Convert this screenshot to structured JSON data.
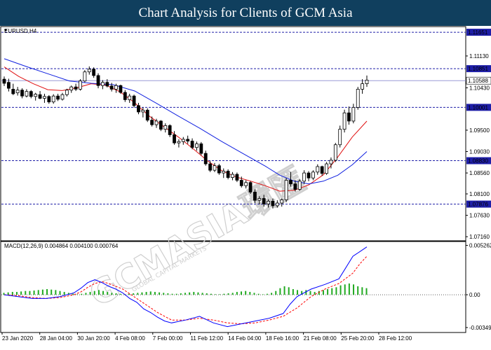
{
  "title": "Chart Analysis for Clients of GCM Asia",
  "watermark": {
    "main": "GCMASIA環匯",
    "sub": "GLOBAL CAPITAL MARKETS"
  },
  "chart_data": [
    {
      "type": "candlestick",
      "symbol": "EURUSD,H4",
      "ylim": [
        1.0707,
        1.11775
      ],
      "y_ticks": [
        "1.11130",
        "1.10430",
        "1.09500",
        "1.09030",
        "1.08560",
        "1.08100",
        "1.07630",
        "1.07160"
      ],
      "x_labels": [
        "23 Jan 2020",
        "28 Jan 04:00",
        "30 Jan 20:00",
        "4 Feb 08:00",
        "7 Feb 00:00",
        "11 Feb 12:00",
        "14 Feb 04:00",
        "18 Feb 16:00",
        "21 Feb 08:00",
        "25 Feb 20:00",
        "28 Feb 12:00"
      ],
      "levels": [
        {
          "value": 1.11651,
          "label": "1.11651"
        },
        {
          "value": 1.10851,
          "label": "1.10851"
        },
        {
          "value": 1.10001,
          "label": "1.10001"
        },
        {
          "value": 1.0883,
          "label": "1.08830"
        },
        {
          "value": 1.07876,
          "label": "1.07876"
        }
      ],
      "current_price": {
        "value": 1.10588,
        "label": "1.10588"
      },
      "colors": {
        "levels": "#1e1ea8",
        "fast_ma": "#e01010",
        "slow_ma": "#1020e0",
        "candle": "#000000",
        "current": "#0000ff"
      },
      "series": [
        {
          "name": "Fast MA",
          "color": "#e01010",
          "points": [
            [
              0,
              1.1089
            ],
            [
              10,
              1.1068
            ],
            [
              20,
              1.1052
            ],
            [
              30,
              1.1039
            ],
            [
              40,
              1.1037
            ],
            [
              50,
              1.1043
            ],
            [
              60,
              1.1052
            ],
            [
              70,
              1.1049
            ],
            [
              80,
              1.1034
            ],
            [
              90,
              1.101
            ],
            [
              100,
              1.0981
            ],
            [
              110,
              1.0958
            ],
            [
              120,
              1.0935
            ],
            [
              130,
              1.091
            ],
            [
              140,
              1.0883
            ],
            [
              150,
              1.0861
            ],
            [
              160,
              1.0847
            ],
            [
              170,
              1.0838
            ],
            [
              180,
              1.0828
            ],
            [
              190,
              1.0816
            ],
            [
              200,
              1.0818
            ],
            [
              210,
              1.083
            ],
            [
              220,
              1.0852
            ],
            [
              230,
              1.0891
            ],
            [
              240,
              1.0935
            ],
            [
              250,
              1.097
            ]
          ]
        },
        {
          "name": "Slow MA",
          "color": "#1020e0",
          "points": [
            [
              0,
              1.1107
            ],
            [
              15,
              1.109
            ],
            [
              30,
              1.1074
            ],
            [
              45,
              1.1058
            ],
            [
              60,
              1.1053
            ],
            [
              75,
              1.105
            ],
            [
              90,
              1.1036
            ],
            [
              105,
              1.1009
            ],
            [
              120,
              1.0981
            ],
            [
              135,
              1.0954
            ],
            [
              150,
              1.0925
            ],
            [
              165,
              1.0898
            ],
            [
              180,
              1.0871
            ],
            [
              190,
              1.0851
            ],
            [
              200,
              1.0838
            ],
            [
              210,
              1.0832
            ],
            [
              220,
              1.0838
            ],
            [
              230,
              1.0851
            ],
            [
              240,
              1.0874
            ],
            [
              250,
              1.0903
            ]
          ]
        }
      ],
      "candles": [
        [
          1.1062,
          1.1068,
          1.1047,
          1.1053
        ],
        [
          1.1055,
          1.1063,
          1.1035,
          1.1042
        ],
        [
          1.104,
          1.1052,
          1.1027,
          1.103
        ],
        [
          1.1032,
          1.1045,
          1.1026,
          1.1038
        ],
        [
          1.1038,
          1.1042,
          1.102,
          1.1025
        ],
        [
          1.1025,
          1.104,
          1.1022,
          1.1035
        ],
        [
          1.1035,
          1.1038,
          1.102,
          1.1024
        ],
        [
          1.1024,
          1.1032,
          1.1015,
          1.1029
        ],
        [
          1.1028,
          1.1036,
          1.1018,
          1.102
        ],
        [
          1.102,
          1.103,
          1.101,
          1.1024
        ],
        [
          1.1024,
          1.1027,
          1.1008,
          1.1012
        ],
        [
          1.1012,
          1.1029,
          1.1008,
          1.1025
        ],
        [
          1.1025,
          1.103,
          1.1014,
          1.1018
        ],
        [
          1.1018,
          1.1032,
          1.1015,
          1.1028
        ],
        [
          1.1028,
          1.1041,
          1.1024,
          1.1038
        ],
        [
          1.1038,
          1.1048,
          1.1032,
          1.1045
        ],
        [
          1.1045,
          1.1052,
          1.1036,
          1.104
        ],
        [
          1.104,
          1.1062,
          1.1037,
          1.1058
        ],
        [
          1.1058,
          1.1082,
          1.1055,
          1.1078
        ],
        [
          1.1078,
          1.109,
          1.1072,
          1.1084
        ],
        [
          1.1084,
          1.1088,
          1.1065,
          1.107
        ],
        [
          1.107,
          1.1075,
          1.1042,
          1.1048
        ],
        [
          1.1048,
          1.106,
          1.104,
          1.1055
        ],
        [
          1.1055,
          1.1062,
          1.1044,
          1.1047
        ],
        [
          1.1047,
          1.1054,
          1.1035,
          1.104
        ],
        [
          1.104,
          1.1052,
          1.1032,
          1.1048
        ],
        [
          1.1048,
          1.105,
          1.103,
          1.1033
        ],
        [
          1.1033,
          1.1038,
          1.1012,
          1.1017
        ],
        [
          1.1017,
          1.103,
          1.101,
          1.1025
        ],
        [
          1.1025,
          1.1028,
          1.1,
          1.1004
        ],
        [
          1.1004,
          1.101,
          1.0985,
          1.099
        ],
        [
          1.099,
          1.1,
          1.0978,
          1.0994
        ],
        [
          1.0994,
          1.0998,
          1.0968,
          1.0972
        ],
        [
          1.0972,
          1.098,
          1.0958,
          1.0962
        ],
        [
          1.0962,
          1.0975,
          1.0955,
          1.097
        ],
        [
          1.097,
          1.0972,
          1.0948,
          1.0952
        ],
        [
          1.0952,
          1.0965,
          1.0945,
          1.096
        ],
        [
          1.096,
          1.0963,
          1.0935,
          1.094
        ],
        [
          1.094,
          1.0948,
          1.0918,
          1.0922
        ],
        [
          1.0922,
          1.093,
          1.0912,
          1.0925
        ],
        [
          1.0925,
          1.0935,
          1.0918,
          1.093
        ],
        [
          1.093,
          1.0938,
          1.092,
          1.0926
        ],
        [
          1.0926,
          1.0932,
          1.0908,
          1.0912
        ],
        [
          1.0912,
          1.0925,
          1.0905,
          1.092
        ],
        [
          1.092,
          1.0924,
          1.0895,
          1.0899
        ],
        [
          1.0899,
          1.0905,
          1.0872,
          1.0876
        ],
        [
          1.0876,
          1.0882,
          1.0858,
          1.0862
        ],
        [
          1.0862,
          1.0878,
          1.0858,
          1.0872
        ],
        [
          1.0872,
          1.0876,
          1.0852,
          1.0856
        ],
        [
          1.0856,
          1.0866,
          1.0845,
          1.086
        ],
        [
          1.086,
          1.0864,
          1.0842,
          1.0846
        ],
        [
          1.0846,
          1.0858,
          1.084,
          1.0853
        ],
        [
          1.0853,
          1.0857,
          1.0836,
          1.084
        ],
        [
          1.084,
          1.0848,
          1.0824,
          1.0828
        ],
        [
          1.0828,
          1.084,
          1.0822,
          1.0835
        ],
        [
          1.0835,
          1.0838,
          1.081,
          1.0814
        ],
        [
          1.0814,
          1.082,
          1.079,
          1.0796
        ],
        [
          1.0796,
          1.0805,
          1.0787,
          1.08
        ],
        [
          1.08,
          1.0808,
          1.0782,
          1.0788
        ],
        [
          1.0788,
          1.0798,
          1.078,
          1.0794
        ],
        [
          1.0794,
          1.08,
          1.0778,
          1.0784
        ],
        [
          1.0784,
          1.0796,
          1.078,
          1.079
        ],
        [
          1.079,
          1.08,
          1.0782,
          1.0797
        ],
        [
          1.0797,
          1.0845,
          1.0792,
          1.084
        ],
        [
          1.084,
          1.0858,
          1.0826,
          1.0832
        ],
        [
          1.0832,
          1.084,
          1.0815,
          1.082
        ],
        [
          1.082,
          1.0842,
          1.0817,
          1.0838
        ],
        [
          1.0838,
          1.0862,
          1.0832,
          1.0856
        ],
        [
          1.0856,
          1.086,
          1.0838,
          1.0845
        ],
        [
          1.0845,
          1.0862,
          1.084,
          1.0858
        ],
        [
          1.0858,
          1.0875,
          1.0852,
          1.087
        ],
        [
          1.087,
          1.0872,
          1.085,
          1.0855
        ],
        [
          1.0855,
          1.088,
          1.0852,
          1.0876
        ],
        [
          1.0876,
          1.089,
          1.0866,
          1.0884
        ],
        [
          1.0884,
          1.0922,
          1.088,
          1.0918
        ],
        [
          1.0918,
          1.096,
          1.0912,
          1.0952
        ],
        [
          1.0952,
          1.0995,
          1.0945,
          1.0988
        ],
        [
          1.0988,
          1.1002,
          1.0962,
          1.097
        ],
        [
          1.097,
          1.1008,
          1.0965,
          1.1
        ],
        [
          1.1,
          1.1045,
          1.0995,
          1.104
        ],
        [
          1.104,
          1.1062,
          1.103,
          1.1052
        ],
        [
          1.1052,
          1.107,
          1.1045,
          1.106
        ]
      ]
    },
    {
      "type": "line",
      "name": "MACD(12,26,9) 0.004864 0.004100 0.000764",
      "ylim": [
        -0.00395,
        0.0056
      ],
      "y_ticks": [
        "0.005262",
        "0.00",
        "-0.003495"
      ],
      "colors": {
        "histogram": "#22aa22",
        "macd": "#0000ff",
        "signal": "#ff0000",
        "zero": "#000000"
      },
      "macd": [
        [
          0,
          0
        ],
        [
          20,
          -0.0002
        ],
        [
          40,
          -0.0004
        ],
        [
          60,
          -0.0004
        ],
        [
          80,
          -0.0002
        ],
        [
          100,
          0.0002
        ],
        [
          110,
          0.0007
        ],
        [
          120,
          0.0013
        ],
        [
          130,
          0.0016
        ],
        [
          140,
          0.0013
        ],
        [
          150,
          0.0009
        ],
        [
          160,
          0.0006
        ],
        [
          170,
          0.0002
        ],
        [
          180,
          -0.0004
        ],
        [
          190,
          -0.0008
        ],
        [
          200,
          -0.0015
        ],
        [
          210,
          -0.0019
        ],
        [
          220,
          -0.0024
        ],
        [
          230,
          -0.0028
        ],
        [
          240,
          -0.003
        ],
        [
          260,
          -0.0027
        ],
        [
          280,
          -0.0023
        ],
        [
          300,
          -0.003
        ],
        [
          320,
          -0.0034
        ],
        [
          340,
          -0.0031
        ],
        [
          360,
          -0.0028
        ],
        [
          380,
          -0.0025
        ],
        [
          400,
          -0.002
        ],
        [
          410,
          -0.001
        ],
        [
          420,
          -0.0002
        ],
        [
          440,
          0.0006
        ],
        [
          460,
          0.0011
        ],
        [
          480,
          0.0017
        ],
        [
          490,
          0.0029
        ],
        [
          500,
          0.0041
        ],
        [
          510,
          0.0046
        ],
        [
          520,
          0.0051
        ]
      ],
      "signal": [
        [
          0,
          0
        ],
        [
          20,
          -0.0001
        ],
        [
          40,
          -0.0003
        ],
        [
          60,
          -0.0004
        ],
        [
          80,
          -0.0003
        ],
        [
          100,
          0
        ],
        [
          110,
          0.0003
        ],
        [
          120,
          0.0008
        ],
        [
          130,
          0.0012
        ],
        [
          140,
          0.0014
        ],
        [
          150,
          0.0012
        ],
        [
          160,
          0.0009
        ],
        [
          170,
          0.0006
        ],
        [
          180,
          0.0001
        ],
        [
          190,
          -0.0004
        ],
        [
          200,
          -0.0009
        ],
        [
          210,
          -0.0014
        ],
        [
          220,
          -0.0019
        ],
        [
          230,
          -0.0023
        ],
        [
          240,
          -0.0027
        ],
        [
          260,
          -0.0027
        ],
        [
          280,
          -0.0025
        ],
        [
          300,
          -0.0027
        ],
        [
          320,
          -0.003
        ],
        [
          340,
          -0.0031
        ],
        [
          360,
          -0.003
        ],
        [
          380,
          -0.0027
        ],
        [
          400,
          -0.0023
        ],
        [
          420,
          -0.0014
        ],
        [
          440,
          -0.0002
        ],
        [
          460,
          0.0006
        ],
        [
          480,
          0.0012
        ],
        [
          500,
          0.0023
        ],
        [
          510,
          0.0033
        ],
        [
          520,
          0.0041
        ]
      ],
      "histogram": [
        0.0002,
        0.00025,
        0.0003,
        0.0003,
        0.00035,
        0.0004,
        0.0004,
        0.00045,
        0.0005,
        0.00055,
        0.0006,
        0.00055,
        0.0005,
        0.0004,
        0.0003,
        0.0002,
        0.0001,
        5e-05,
        0.0001,
        0.0002,
        0.0003,
        0.0004,
        0.0005,
        0.0004,
        0.0003,
        0.0002,
        0.00015,
        0.0001,
        5e-05,
        0.0001,
        0.00015,
        0.0002,
        0.00025,
        0.0003,
        0.00035,
        0.0003,
        0.00025,
        0.0002,
        0.00015,
        0.0001,
        0.0001,
        0.00015,
        0.0002,
        0.00025,
        0.0003,
        0.00025,
        0.0002,
        0.00015,
        0.0001,
        5e-05,
        5e-05,
        0.0001,
        0.00015,
        0.0002,
        0.0003,
        0.00035,
        0.0004,
        0.0003,
        0.0002,
        0.0001,
        5e-05,
        0.0001,
        0.0002,
        0.0004,
        0.0007,
        0.0009,
        0.0008,
        0.0006,
        0.0005,
        0.0004,
        0.0005,
        0.0004,
        0.0003,
        0.0004,
        0.0005,
        0.0006,
        0.0007,
        0.0008,
        0.001,
        0.0011,
        0.0012,
        0.0011,
        0.0009,
        0.0008,
        0.0007
      ]
    }
  ]
}
